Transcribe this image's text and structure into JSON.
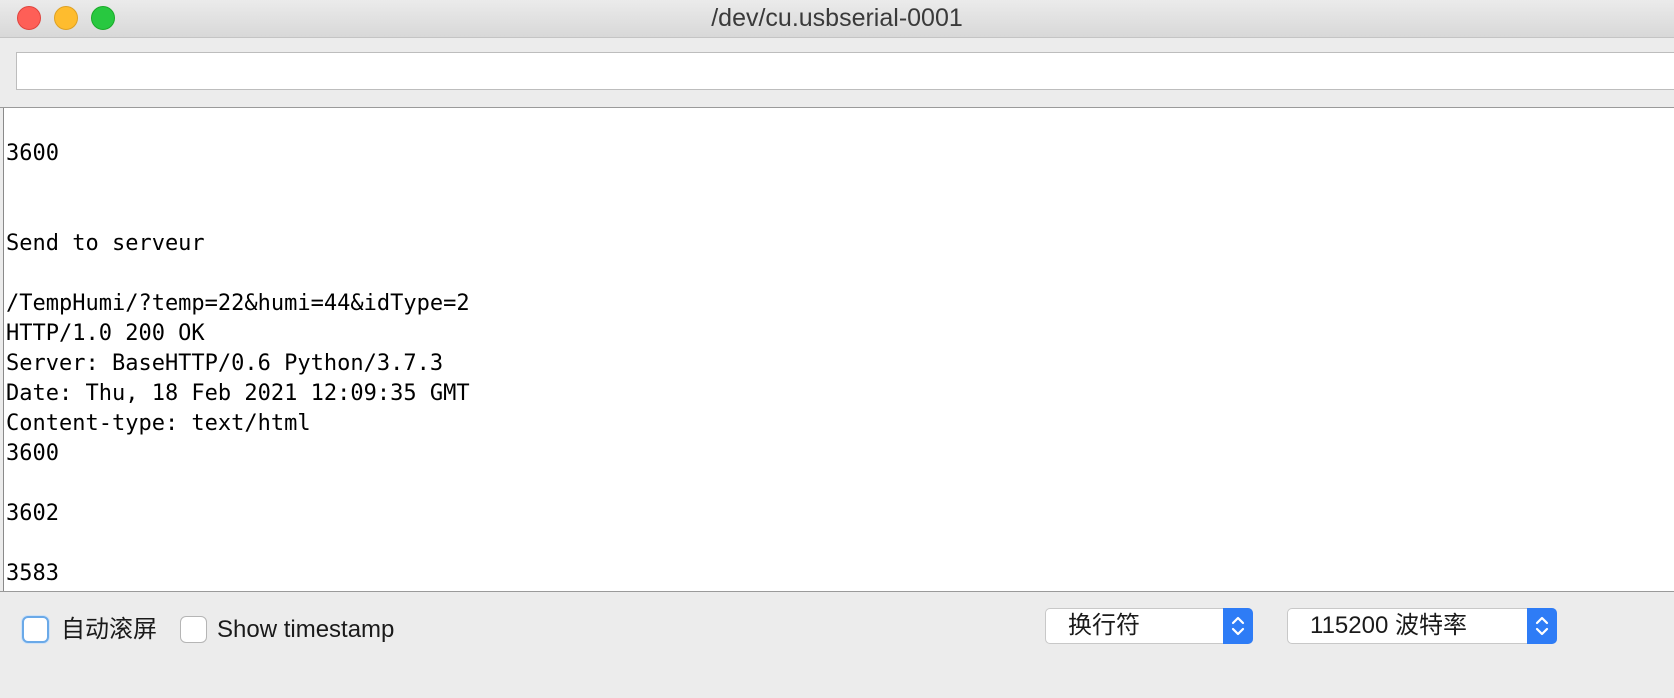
{
  "window": {
    "title": "/dev/cu.usbserial-0001"
  },
  "send_input": {
    "value": "",
    "placeholder": ""
  },
  "output": {
    "lines": [
      "3600",
      "",
      "",
      "Send to serveur",
      "",
      "/TempHumi/?temp=22&humi=44&idType=2",
      "HTTP/1.0 200 OK",
      "Server: BaseHTTP/0.6 Python/3.7.3",
      "Date: Thu, 18 Feb 2021 12:09:35 GMT",
      "Content-type: text/html",
      "3600",
      "",
      "3602",
      "",
      "3583"
    ]
  },
  "footer": {
    "autoscroll_label": "自动滚屏",
    "autoscroll_checked": false,
    "timestamp_label": "Show timestamp",
    "timestamp_checked": false,
    "line_ending_value": "换行符",
    "baud_rate_value": "115200 波特率"
  },
  "colors": {
    "close": "#fe5f57",
    "minimize": "#febc2e",
    "maximize": "#28c840",
    "select_accent": "#2e7cf6"
  }
}
